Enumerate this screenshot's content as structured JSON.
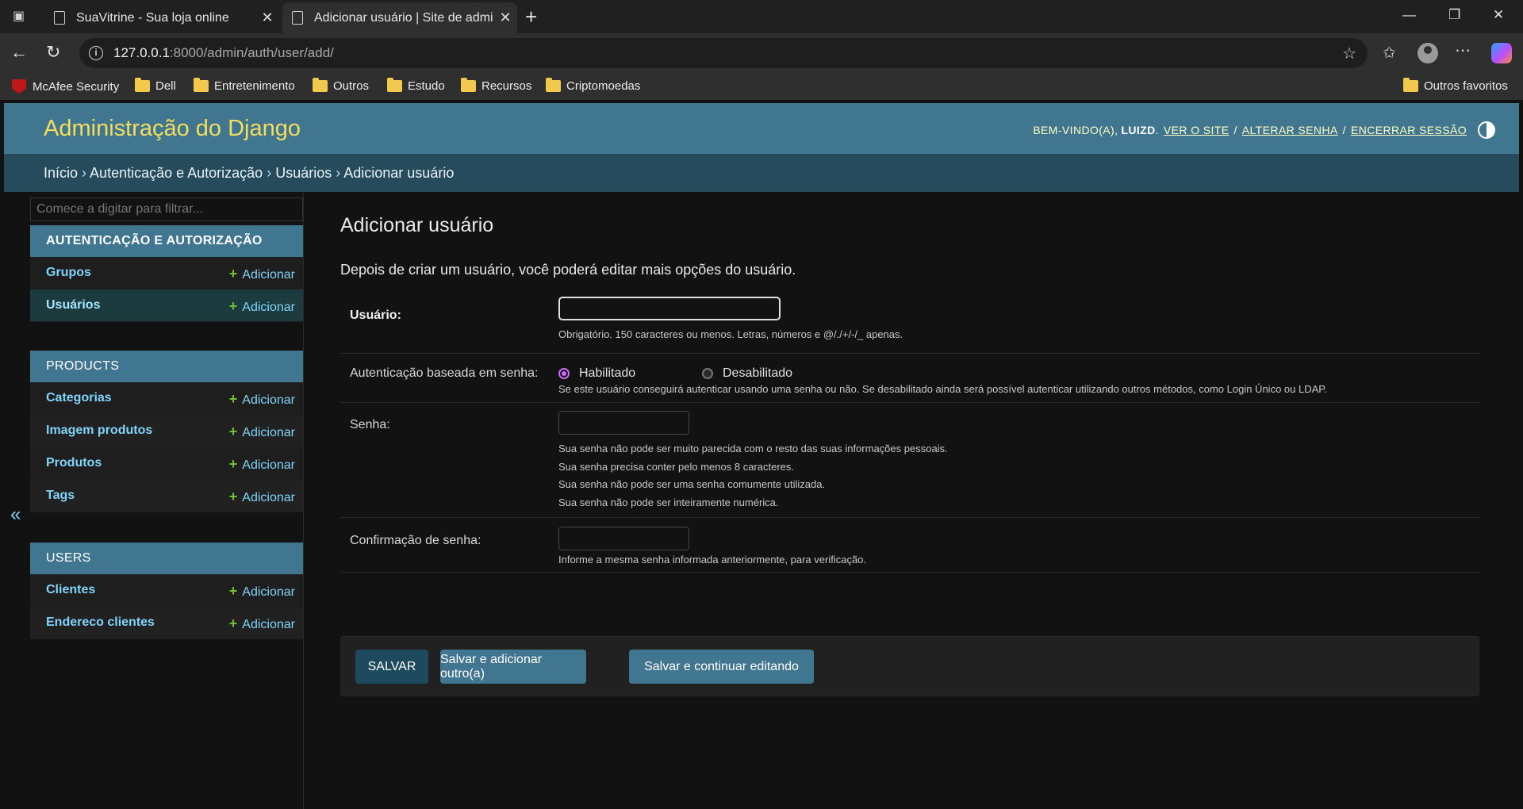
{
  "browser": {
    "tabs": [
      {
        "title": "SuaVitrine - Sua loja online"
      },
      {
        "title": "Adicionar usuário | Site de admini"
      }
    ],
    "url": {
      "host": "127.0.0.1",
      "rest": ":8000/admin/auth/user/add/"
    },
    "bookmarks": [
      "McAfee Security",
      "Dell",
      "Entretenimento",
      "Outros",
      "Estudo",
      "Recursos",
      "Criptomoedas"
    ],
    "other_favorites": "Outros favoritos"
  },
  "admin": {
    "brand": "Administração do Django",
    "welcome": "BEM-VINDO(A),",
    "username": "LUIZD",
    "links": [
      "VER O SITE",
      "ALTERAR SENHA",
      "ENCERRAR SESSÃO"
    ],
    "breadcrumbs": [
      "Início",
      "Autenticação e Autorização",
      "Usuários",
      "Adicionar usuário"
    ]
  },
  "sidebar": {
    "filter_placeholder": "Comece a digitar para filtrar...",
    "add_label": "Adicionar",
    "modules": [
      {
        "caption": "AUTENTICAÇÃO E AUTORIZAÇÃO",
        "models": [
          "Grupos",
          "Usuários"
        ]
      },
      {
        "caption": "PRODUCTS",
        "models": [
          "Categorias",
          "Imagem produtos",
          "Produtos",
          "Tags"
        ]
      },
      {
        "caption": "USERS",
        "models": [
          "Clientes",
          "Endereco clientes"
        ]
      }
    ],
    "collapse_glyph": "«"
  },
  "form": {
    "title": "Adicionar usuário",
    "intro": "Depois de criar um usuário, você poderá editar mais opções do usuário.",
    "username": {
      "label": "Usuário:",
      "value": "",
      "help": "Obrigatório. 150 caracteres ou menos. Letras, números e @/./+/-/_ apenas."
    },
    "password_auth": {
      "label": "Autenticação baseada em senha:",
      "options": [
        "Habilitado",
        "Desabilitado"
      ],
      "selected": "Habilitado",
      "help": "Se este usuário conseguirá autenticar usando uma senha ou não. Se desabilitado ainda será possível autenticar utilizando outros métodos, como Login Único ou LDAP."
    },
    "password": {
      "label": "Senha:",
      "help": [
        "Sua senha não pode ser muito parecida com o resto das suas informações pessoais.",
        "Sua senha precisa conter pelo menos 8 caracteres.",
        "Sua senha não pode ser uma senha comumente utilizada.",
        "Sua senha não pode ser inteiramente numérica."
      ]
    },
    "password2": {
      "label": "Confirmação de senha:",
      "help": "Informe a mesma senha informada anteriormente, para verificação."
    },
    "buttons": [
      "SALVAR",
      "Salvar e adicionar outro(a)",
      "Salvar e continuar editando"
    ]
  },
  "colors": {
    "header": "#417690",
    "breadcrumbs": "#264b5d",
    "brand": "#f5dd5d",
    "link": "#81d4fa",
    "add_plus": "#70bf2b"
  }
}
